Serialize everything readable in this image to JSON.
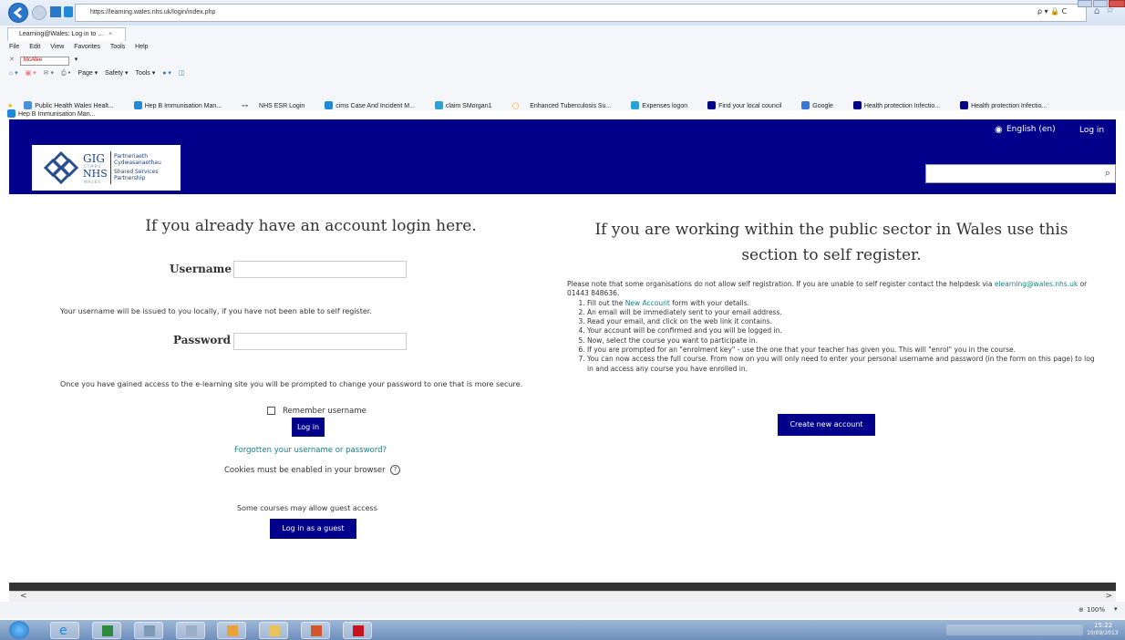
{
  "browser": {
    "url": "https://learning.wales.nhs.uk/login/index.php",
    "tab_title": "Learning@Wales: Log in to ...",
    "tab_close": "×",
    "menu": [
      "File",
      "Edit",
      "View",
      "Favorites",
      "Tools",
      "Help"
    ],
    "mcafee": "McAfee",
    "command_bar": [
      "Page ▾",
      "Safety ▾",
      "Tools ▾"
    ],
    "favorites": [
      "Public Health Wales Healt...",
      "Hep B Immunisation Man...",
      "NHS ESR Login",
      "cims Case And Incident M...",
      "claim SMorgan1",
      "Enhanced Tuberculosis Su...",
      "Expenses logon",
      "Find your local council",
      "Google",
      "Health protection Infectio...",
      "Health protection Infectio...",
      "Hep B Immunisation Man..."
    ],
    "address_controls": "ρ ▾ 🔒 C",
    "zoom": "100%",
    "clock_time": "15:22",
    "clock_date": "10/09/2013"
  },
  "site": {
    "language": "English (en)",
    "login_link": "Log in",
    "logo": {
      "gig": "GIG",
      "cymru": "CYMRU",
      "nhs": "NHS",
      "wales": "WALES",
      "line1": "Partneriaeth",
      "line2": "Cydwasanaethau",
      "line3": "Shared Services",
      "line4": "Partnership"
    },
    "search_icon": "⌕"
  },
  "login": {
    "heading": "If you already have an account login here.",
    "username_label": "Username",
    "username_value": "",
    "username_note": "Your username will be issued to you locally, if you have not been able to self register.",
    "password_label": "Password",
    "password_value": "",
    "password_note": "Once you have gained access to the e-learning site you will be prompted to change your password to one that is more secure.",
    "remember_label": "Remember username",
    "login_button": "Log in",
    "forgot_link": "Forgotten your username or password?",
    "cookies_note": "Cookies must be enabled in your browser",
    "guest_note": "Some courses may allow guest access",
    "guest_button": "Log in as a guest"
  },
  "register": {
    "heading_line1": "If you are working within the public sector in Wales use this",
    "heading_line2": "section to self register.",
    "intro_pre": "Please note that some organisations do not allow self registration. If you are unable to self register contact the helpdesk via",
    "email": "elearning@wales.nhs.uk",
    "intro_post": "or 01443 848636.",
    "step1_pre": "Fill out the",
    "step1_link": "New Account",
    "step1_post": "form with your details.",
    "steps": [
      "An email will be immediately sent to your email address.",
      "Read your email, and click on the web link it contains.",
      "Your account will be confirmed and you will be logged in.",
      "Now, select the course you want to participate in.",
      "If you are prompted for an \"enrolment key\" - use the one that your teacher has given you. This will \"enrol\" you in the course.",
      "You can now access the full course. From now on you will only need to enter your personal username and password (in the form on this page) to log in and access any course you have enrolled in."
    ],
    "create_button": "Create new account"
  },
  "colors": {
    "brand_navy": "#00008b",
    "link_teal": "#1a7f7f"
  }
}
